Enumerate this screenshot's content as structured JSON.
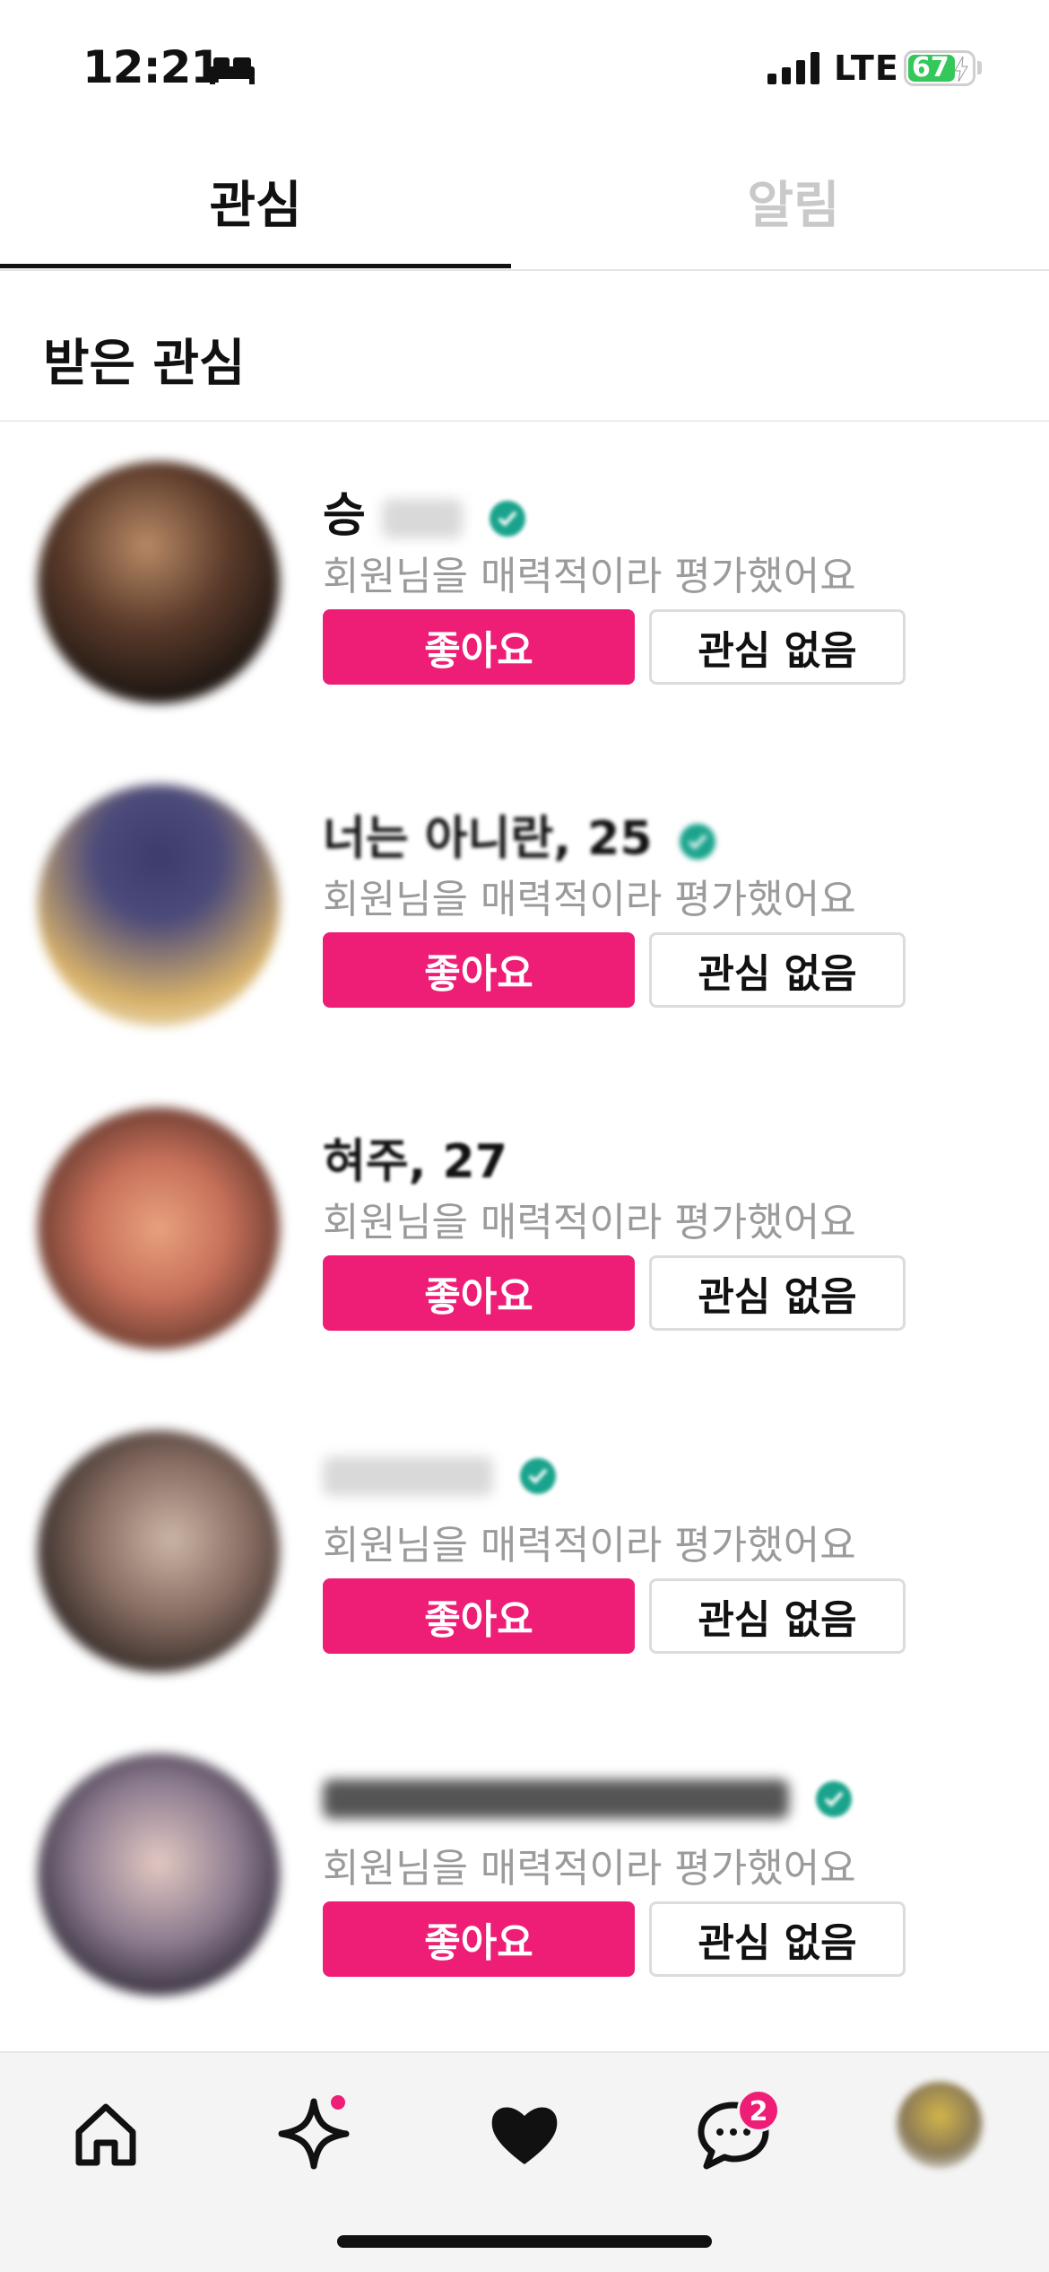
{
  "status": {
    "time": "12:21",
    "network": "LTE",
    "battery": "67"
  },
  "tabs": [
    {
      "label": "관심",
      "active": true
    },
    {
      "label": "알림",
      "active": false
    }
  ],
  "section": {
    "title": "받은 관심"
  },
  "items": [
    {
      "name_visible": "승",
      "subtitle": "회원님을 매력적이라 평가했어요",
      "like_label": "좋아요",
      "pass_label": "관심 없음"
    },
    {
      "name_visible": "너는 아니란, 25",
      "subtitle": "회원님을 매력적이라 평가했어요",
      "like_label": "좋아요",
      "pass_label": "관심 없음"
    },
    {
      "name_visible": "혀주, 27",
      "subtitle": "회원님을 매력적이라 평가했어요",
      "like_label": "좋아요",
      "pass_label": "관심 없음"
    },
    {
      "name_visible": "",
      "subtitle": "회원님을 매력적이라 평가했어요",
      "like_label": "좋아요",
      "pass_label": "관심 없음"
    },
    {
      "name_visible": "",
      "subtitle": "회원님을 매력적이라 평가했어요",
      "like_label": "좋아요",
      "pass_label": "관심 없음"
    }
  ],
  "tab_bar": {
    "chat_badge": "2"
  },
  "colors": {
    "accent": "#ee1e76",
    "verified": "#1aa38c",
    "inactive_tab": "#c9c9c9"
  }
}
